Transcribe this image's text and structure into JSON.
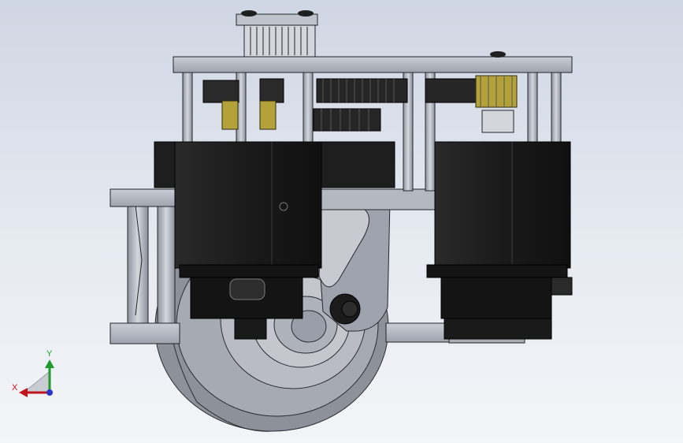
{
  "viewport": {
    "background_top": "#cfd6e3",
    "background_bottom": "#f3f5f8"
  },
  "triad": {
    "x_label": "X",
    "y_label": "Y",
    "x_color": "#c0141c",
    "y_color": "#1f9a2c",
    "z_color": "#2a34c8"
  },
  "model": {
    "motor_color": "#1d1d1d",
    "frame_color": "#b7bcc6",
    "wheel_color": "#a3a7b0",
    "gear_accent": "#b8a53c"
  }
}
